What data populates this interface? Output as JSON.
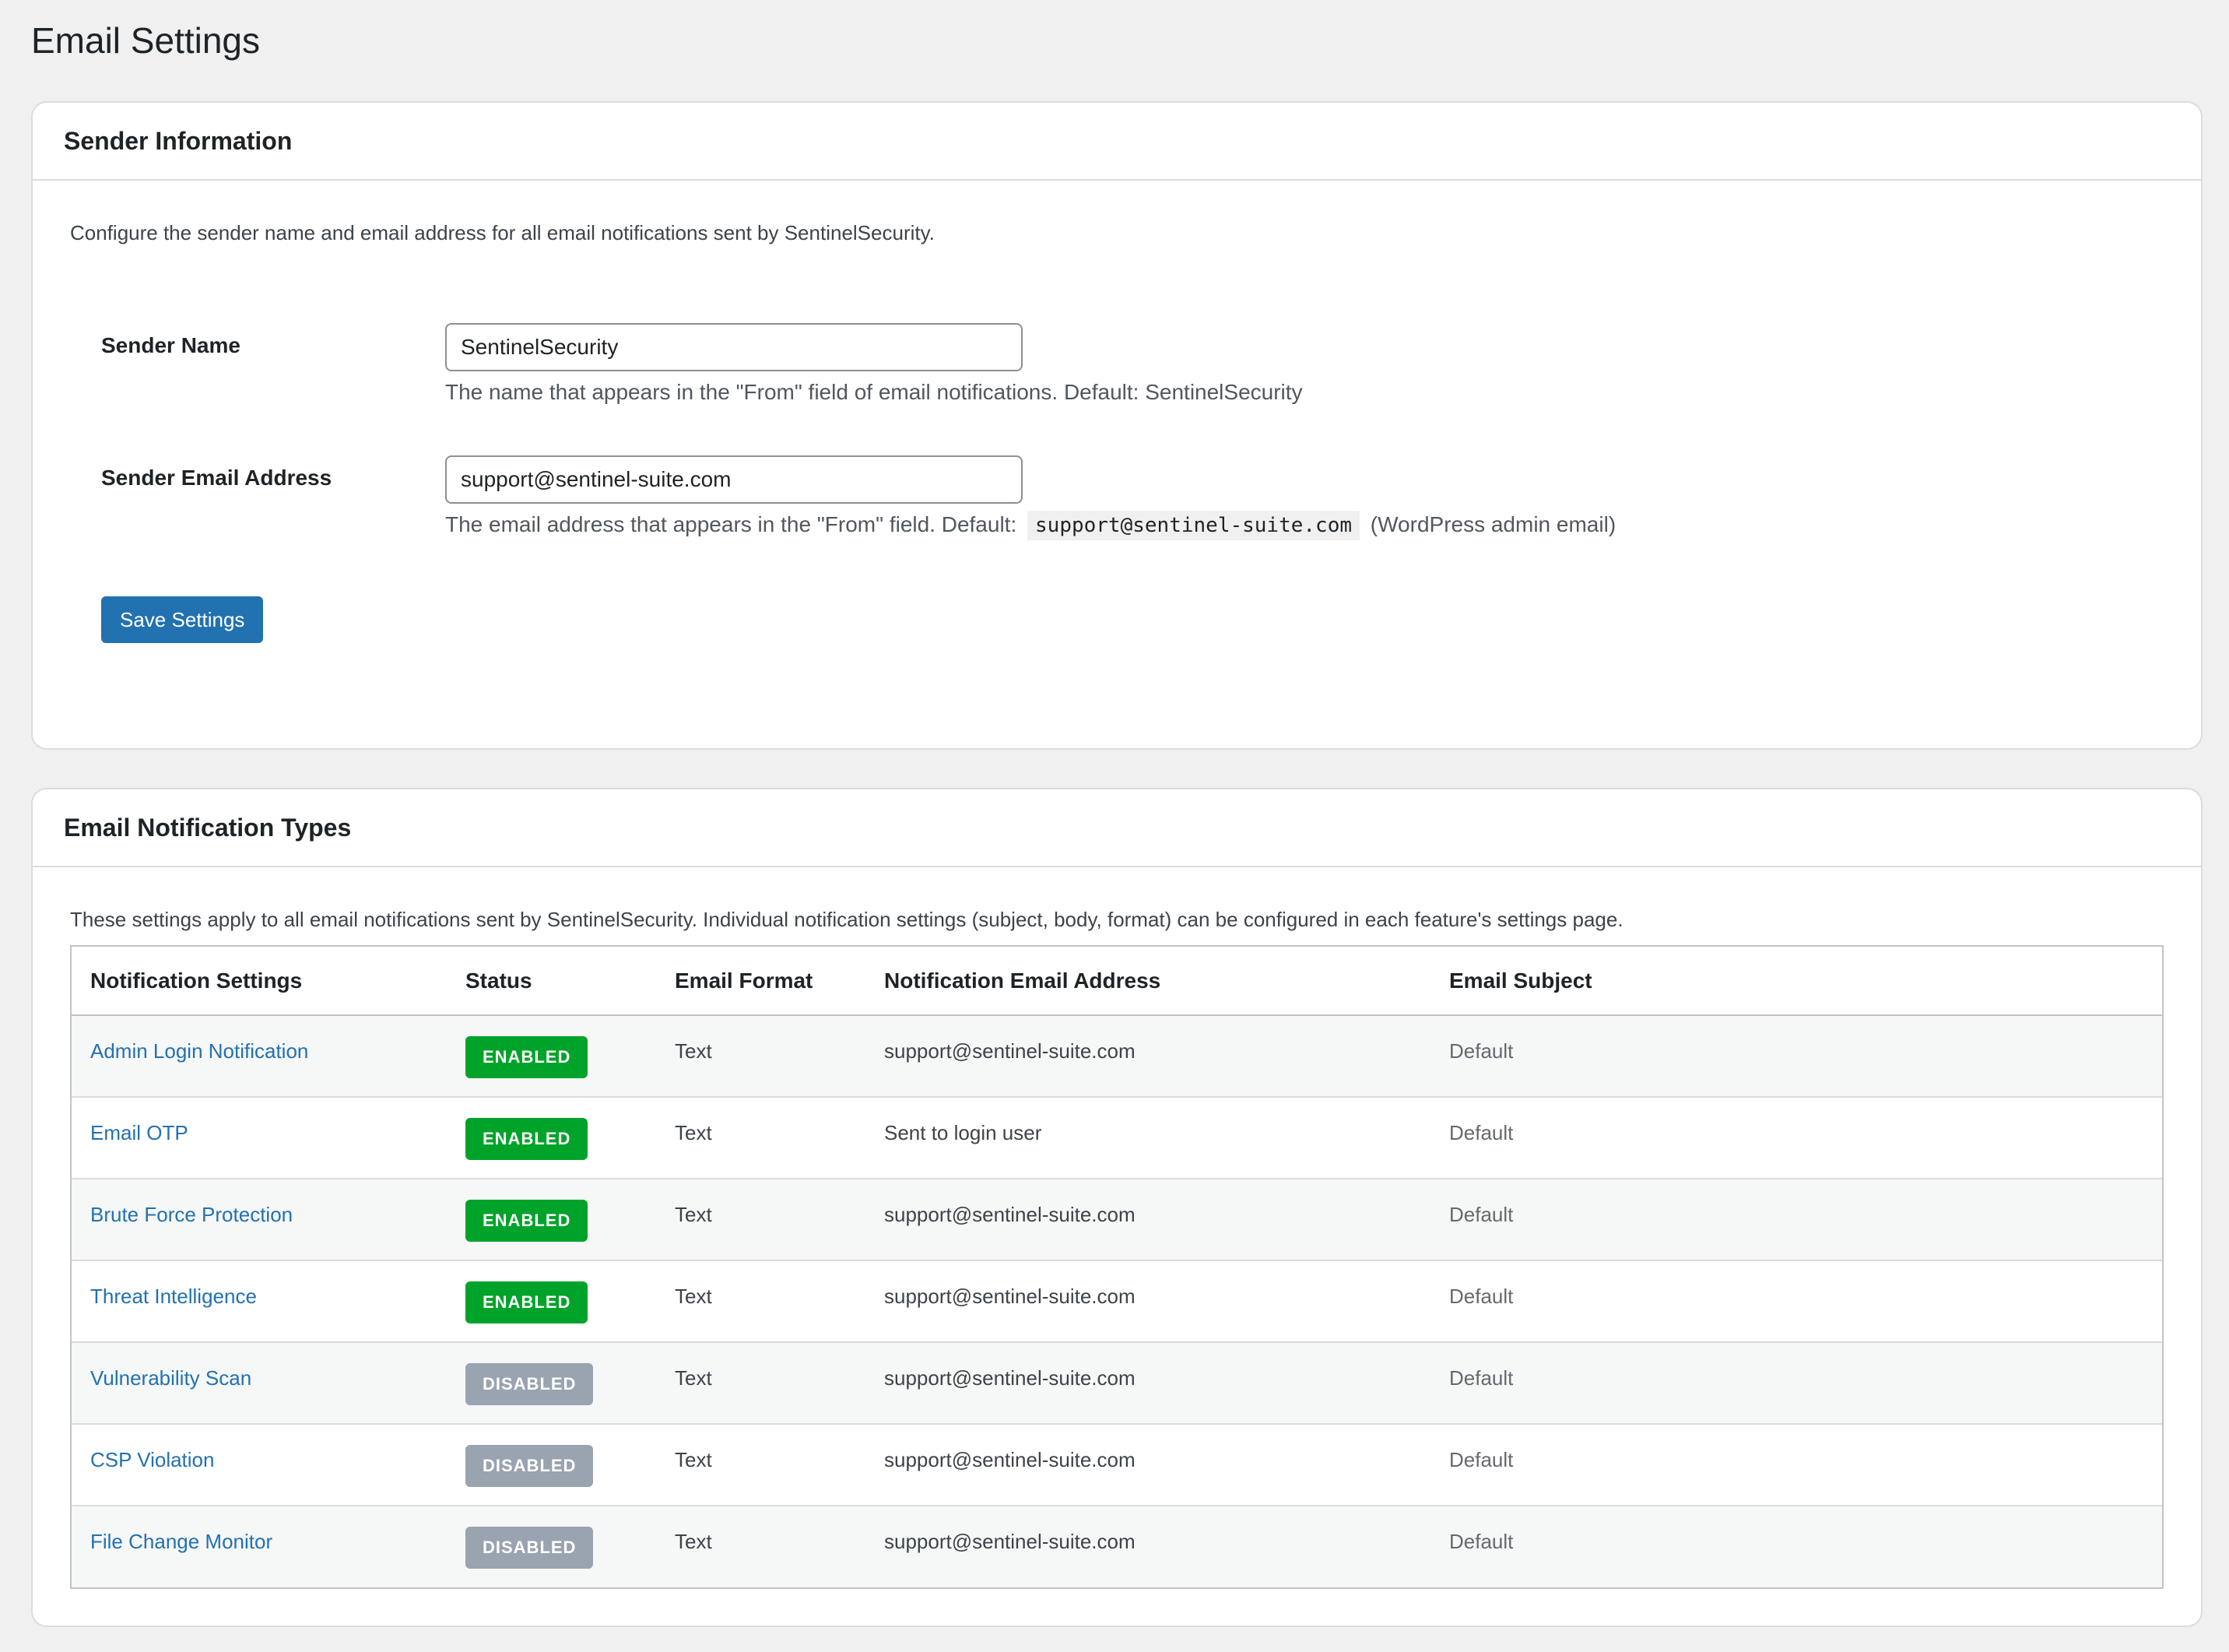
{
  "page": {
    "title": "Email Settings"
  },
  "sender_card": {
    "title": "Sender Information",
    "description": "Configure the sender name and email address for all email notifications sent by SentinelSecurity.",
    "sender_name": {
      "label": "Sender Name",
      "value": "SentinelSecurity",
      "help": "The name that appears in the \"From\" field of email notifications. Default: SentinelSecurity"
    },
    "sender_email": {
      "label": "Sender Email Address",
      "value": "support@sentinel-suite.com",
      "help_prefix": "The email address that appears in the \"From\" field. Default:",
      "help_code": "support@sentinel-suite.com",
      "help_suffix": "(WordPress admin email)"
    },
    "save_label": "Save Settings"
  },
  "types_card": {
    "title": "Email Notification Types",
    "description": "These settings apply to all email notifications sent by SentinelSecurity. Individual notification settings (subject, body, format) can be configured in each feature's settings page.",
    "columns": [
      "Notification Settings",
      "Status",
      "Email Format",
      "Notification Email Address",
      "Email Subject"
    ],
    "rows": [
      {
        "name": "Admin Login Notification",
        "status": "ENABLED",
        "format": "Text",
        "address": "support@sentinel-suite.com",
        "subject": "Default"
      },
      {
        "name": "Email OTP",
        "status": "ENABLED",
        "format": "Text",
        "address": "Sent to login user",
        "subject": "Default"
      },
      {
        "name": "Brute Force Protection",
        "status": "ENABLED",
        "format": "Text",
        "address": "support@sentinel-suite.com",
        "subject": "Default"
      },
      {
        "name": "Threat Intelligence",
        "status": "ENABLED",
        "format": "Text",
        "address": "support@sentinel-suite.com",
        "subject": "Default"
      },
      {
        "name": "Vulnerability Scan",
        "status": "DISABLED",
        "format": "Text",
        "address": "support@sentinel-suite.com",
        "subject": "Default"
      },
      {
        "name": "CSP Violation",
        "status": "DISABLED",
        "format": "Text",
        "address": "support@sentinel-suite.com",
        "subject": "Default"
      },
      {
        "name": "File Change Monitor",
        "status": "DISABLED",
        "format": "Text",
        "address": "support@sentinel-suite.com",
        "subject": "Default"
      }
    ]
  },
  "colors": {
    "accent": "#2271b1",
    "enabled": "#00a32a",
    "disabled": "#9aa3b0",
    "background": "#f0f0f1"
  }
}
